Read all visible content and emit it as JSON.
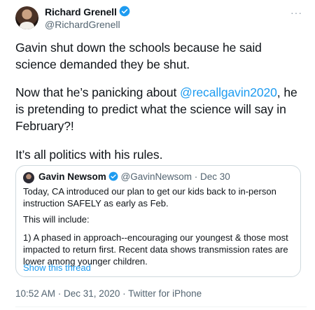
{
  "author": {
    "name": "Richard Grenell",
    "handle": "@RichardGrenell",
    "more_icon": "ellipsis-icon",
    "more_label": "···"
  },
  "tweet": {
    "para1": "Gavin shut down the schools because he said science demanded they be shut.",
    "para2_before": "Now that he’s panicking about ",
    "para2_mention": "@recallgavin2020",
    "para2_after": ", he is pretending to predict what the science will say in February?!",
    "para3": "It’s all politics with his rules."
  },
  "quoted": {
    "name": "Gavin Newsom",
    "handle": "@GavinNewsom",
    "separator": " · ",
    "date": "Dec 30",
    "text1": "Today, CA introduced our plan to get our kids back to in-person instruction SAFELY as early as Feb.",
    "text2": "This will include:",
    "text3": "1) A phased in approach--encouraging our youngest & those most impacted to return first. Recent data shows transmission rates are lower among younger children.",
    "show_thread": "Show this thread"
  },
  "meta": {
    "timestamp": "10:52 AM · Dec 31, 2020 · Twitter for iPhone"
  },
  "colors": {
    "accent": "#1d9bf0",
    "text": "#0f1419",
    "secondary": "#536471",
    "border": "#cfd9de"
  }
}
